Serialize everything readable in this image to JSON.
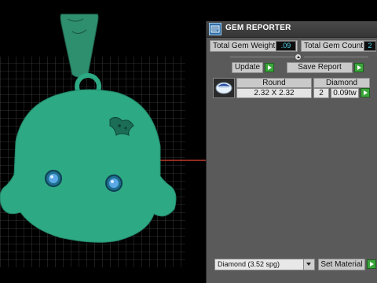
{
  "panel": {
    "title": "GEM REPORTER",
    "total_gem_weight_label": "Total Gem Weight",
    "total_gem_weight_value": ".09",
    "total_gem_count_label": "Total Gem Count",
    "total_gem_count_value": "2",
    "update_label": "Update",
    "save_report_label": "Save Report",
    "table": {
      "header": {
        "size": "Round",
        "material": "Diamond"
      },
      "row": {
        "size": "2.32 X 2.32",
        "count": "2",
        "weight": "0.09tw"
      }
    },
    "material_select_value": "Diamond     (3.52 spg)",
    "set_material_label": "Set Material"
  },
  "colors": {
    "pendant_green": "#2da983",
    "gem_blue": "#5aa8e6",
    "accent_red": "#c0392b",
    "value_text": "#4fd1e8",
    "play_green": "#3aa63a"
  },
  "icons": {
    "title_icon": "gem-reporter-icon",
    "collapse": "collapse-arrow-icon",
    "play": "play-arrow-icon",
    "dropdown": "chevron-down-icon"
  }
}
